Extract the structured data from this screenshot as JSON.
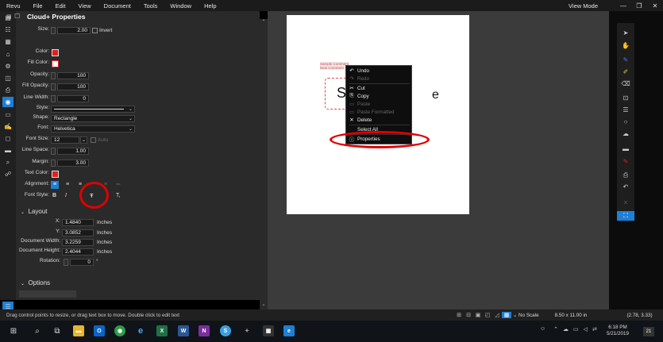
{
  "menu": [
    "Revu",
    "File",
    "Edit",
    "View",
    "Document",
    "Tools",
    "Window",
    "Help"
  ],
  "menu_right": {
    "view_mode": "View Mode",
    "minimize": "—",
    "restore": "❐",
    "close": "✕"
  },
  "panel": {
    "title": "Cloud+ Properties",
    "size": {
      "label": "Size:",
      "value": "2.00",
      "invert": "Invert"
    },
    "color_label": "Color:",
    "fill_color_label": "Fill Color:",
    "opacity": {
      "label": "Opacity:",
      "value": "100"
    },
    "fill_opacity": {
      "label": "Fill Opacity:",
      "value": "100"
    },
    "line_width": {
      "label": "Line Width:",
      "value": "0"
    },
    "style_label": "Style:",
    "shape": {
      "label": "Shape:",
      "value": "Rectangle"
    },
    "font": {
      "label": "Font:",
      "value": "Helvetica"
    },
    "font_size": {
      "label": "Font Size:",
      "value": "12",
      "auto": "Auto"
    },
    "line_space": {
      "label": "Line Space:",
      "value": "1.00"
    },
    "margin": {
      "label": "Margin:",
      "value": "3.00"
    },
    "text_color_label": "Text Color:",
    "alignment_label": "Alignment:",
    "font_style": {
      "label": "Font Style:",
      "bold": "B",
      "italic": "I",
      "strike": "Ŧ",
      "t": "T,"
    },
    "layout": {
      "header": "Layout",
      "x": {
        "label": "X:",
        "value": "1.4840",
        "unit": "Inches"
      },
      "y": {
        "label": "Y:",
        "value": "3.0852",
        "unit": "Inches"
      },
      "doc_width": {
        "label": "Document Width:",
        "value": "3.2259",
        "unit": "Inches"
      },
      "doc_height": {
        "label": "Document Height:",
        "value": "2.4044",
        "unit": "Inches"
      },
      "rotation": {
        "label": "Rotation:",
        "value": "0",
        "unit": "°"
      }
    },
    "options_header": "Options"
  },
  "page": {
    "comment_line1": "Sample Comment",
    "comment_line2": "New Comment",
    "text_left": "S",
    "text_right": "e"
  },
  "context_menu": {
    "items": [
      {
        "label": "Undo",
        "icon": "↶",
        "disabled": false
      },
      {
        "label": "Redo",
        "icon": "↷",
        "disabled": true
      },
      {
        "label": "Cut",
        "icon": "✂",
        "disabled": false
      },
      {
        "label": "Copy",
        "icon": "⎘",
        "disabled": false
      },
      {
        "label": "Paste",
        "icon": "▭",
        "disabled": true
      },
      {
        "label": "Paste Formatted",
        "icon": "▭",
        "disabled": true
      },
      {
        "label": "Delete",
        "icon": "✕",
        "disabled": false
      },
      {
        "label": "Select All",
        "icon": "",
        "disabled": false
      },
      {
        "label": "Properties",
        "icon": "ⓘ",
        "disabled": false
      }
    ]
  },
  "status": {
    "hint": "Drag control points to resize, or drag text box to move. Double click to edit text",
    "scale": "No Scale",
    "page_size": "8.50 x 11.00 in",
    "coords": "(2.78, 3.33)"
  },
  "taskbar": {
    "time": "6:18 PM",
    "date": "5/21/2019",
    "notif": "21"
  },
  "colors": {
    "accent": "#1e7fd6",
    "annotation": "#e00000",
    "stroke_color": "#e02020",
    "cloud_border": "#d05050"
  }
}
